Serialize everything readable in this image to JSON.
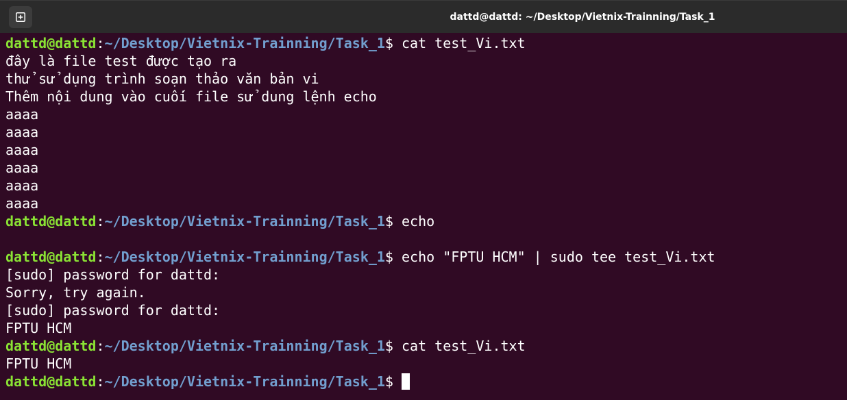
{
  "window": {
    "title": "dattd@dattd: ~/Desktop/Vietnix-Trainning/Task_1"
  },
  "prompt": {
    "user_host": "dattd@dattd",
    "separator": ":",
    "path": "~/Desktop/Vietnix-Trainning/Task_1",
    "symbol": "$ "
  },
  "lines": [
    {
      "type": "prompt",
      "command": "cat test_Vi.txt"
    },
    {
      "type": "output",
      "text": "đây là file test được tạo ra"
    },
    {
      "type": "output",
      "text": "thử sử dụng trình soạn thảo văn bản vi"
    },
    {
      "type": "output",
      "text": "Thêm nội dung vào cuối file sử dung lệnh echo"
    },
    {
      "type": "output",
      "text": "aaaa"
    },
    {
      "type": "output",
      "text": "aaaa"
    },
    {
      "type": "output",
      "text": "aaaa"
    },
    {
      "type": "output",
      "text": "aaaa"
    },
    {
      "type": "output",
      "text": "aaaa"
    },
    {
      "type": "output",
      "text": "aaaa"
    },
    {
      "type": "prompt",
      "command": "echo"
    },
    {
      "type": "output",
      "text": ""
    },
    {
      "type": "prompt",
      "command": "echo \"FPTU HCM\" | sudo tee test_Vi.txt"
    },
    {
      "type": "output",
      "text": "[sudo] password for dattd:"
    },
    {
      "type": "output",
      "text": "Sorry, try again."
    },
    {
      "type": "output",
      "text": "[sudo] password for dattd:"
    },
    {
      "type": "output",
      "text": "FPTU HCM"
    },
    {
      "type": "prompt",
      "command": "cat test_Vi.txt"
    },
    {
      "type": "output",
      "text": "FPTU HCM"
    },
    {
      "type": "prompt",
      "command": "",
      "cursor": true
    }
  ],
  "colors": {
    "background": "#300a24",
    "user_host": "#8ae234",
    "path": "#729fcf",
    "text": "#ffffff",
    "titlebar": "#2b2b2b"
  },
  "icons": {
    "new_tab": "new-tab-icon"
  }
}
